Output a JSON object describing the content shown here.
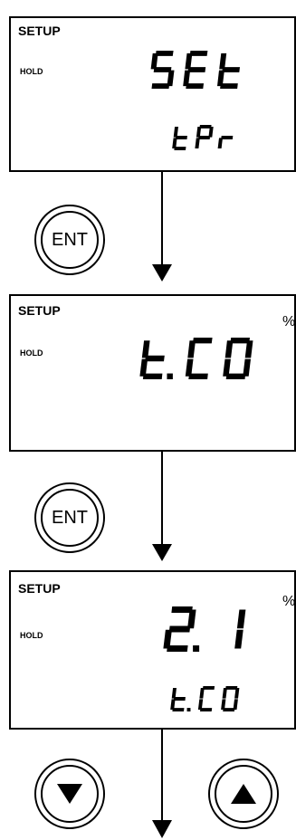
{
  "screens": [
    {
      "setup": "SETUP",
      "hold": "HOLD",
      "main": "SEt",
      "sub": "tPr",
      "unit": ""
    },
    {
      "setup": "SETUP",
      "hold": "HOLD",
      "main": "t.C0",
      "sub": "",
      "unit": "%"
    },
    {
      "setup": "SETUP",
      "hold": "HOLD",
      "main": "2.1",
      "sub": "t.C0",
      "unit": "%"
    }
  ],
  "buttons": {
    "ent_label": "ENT",
    "down": "down-triangle-icon",
    "up": "up-triangle-icon"
  }
}
